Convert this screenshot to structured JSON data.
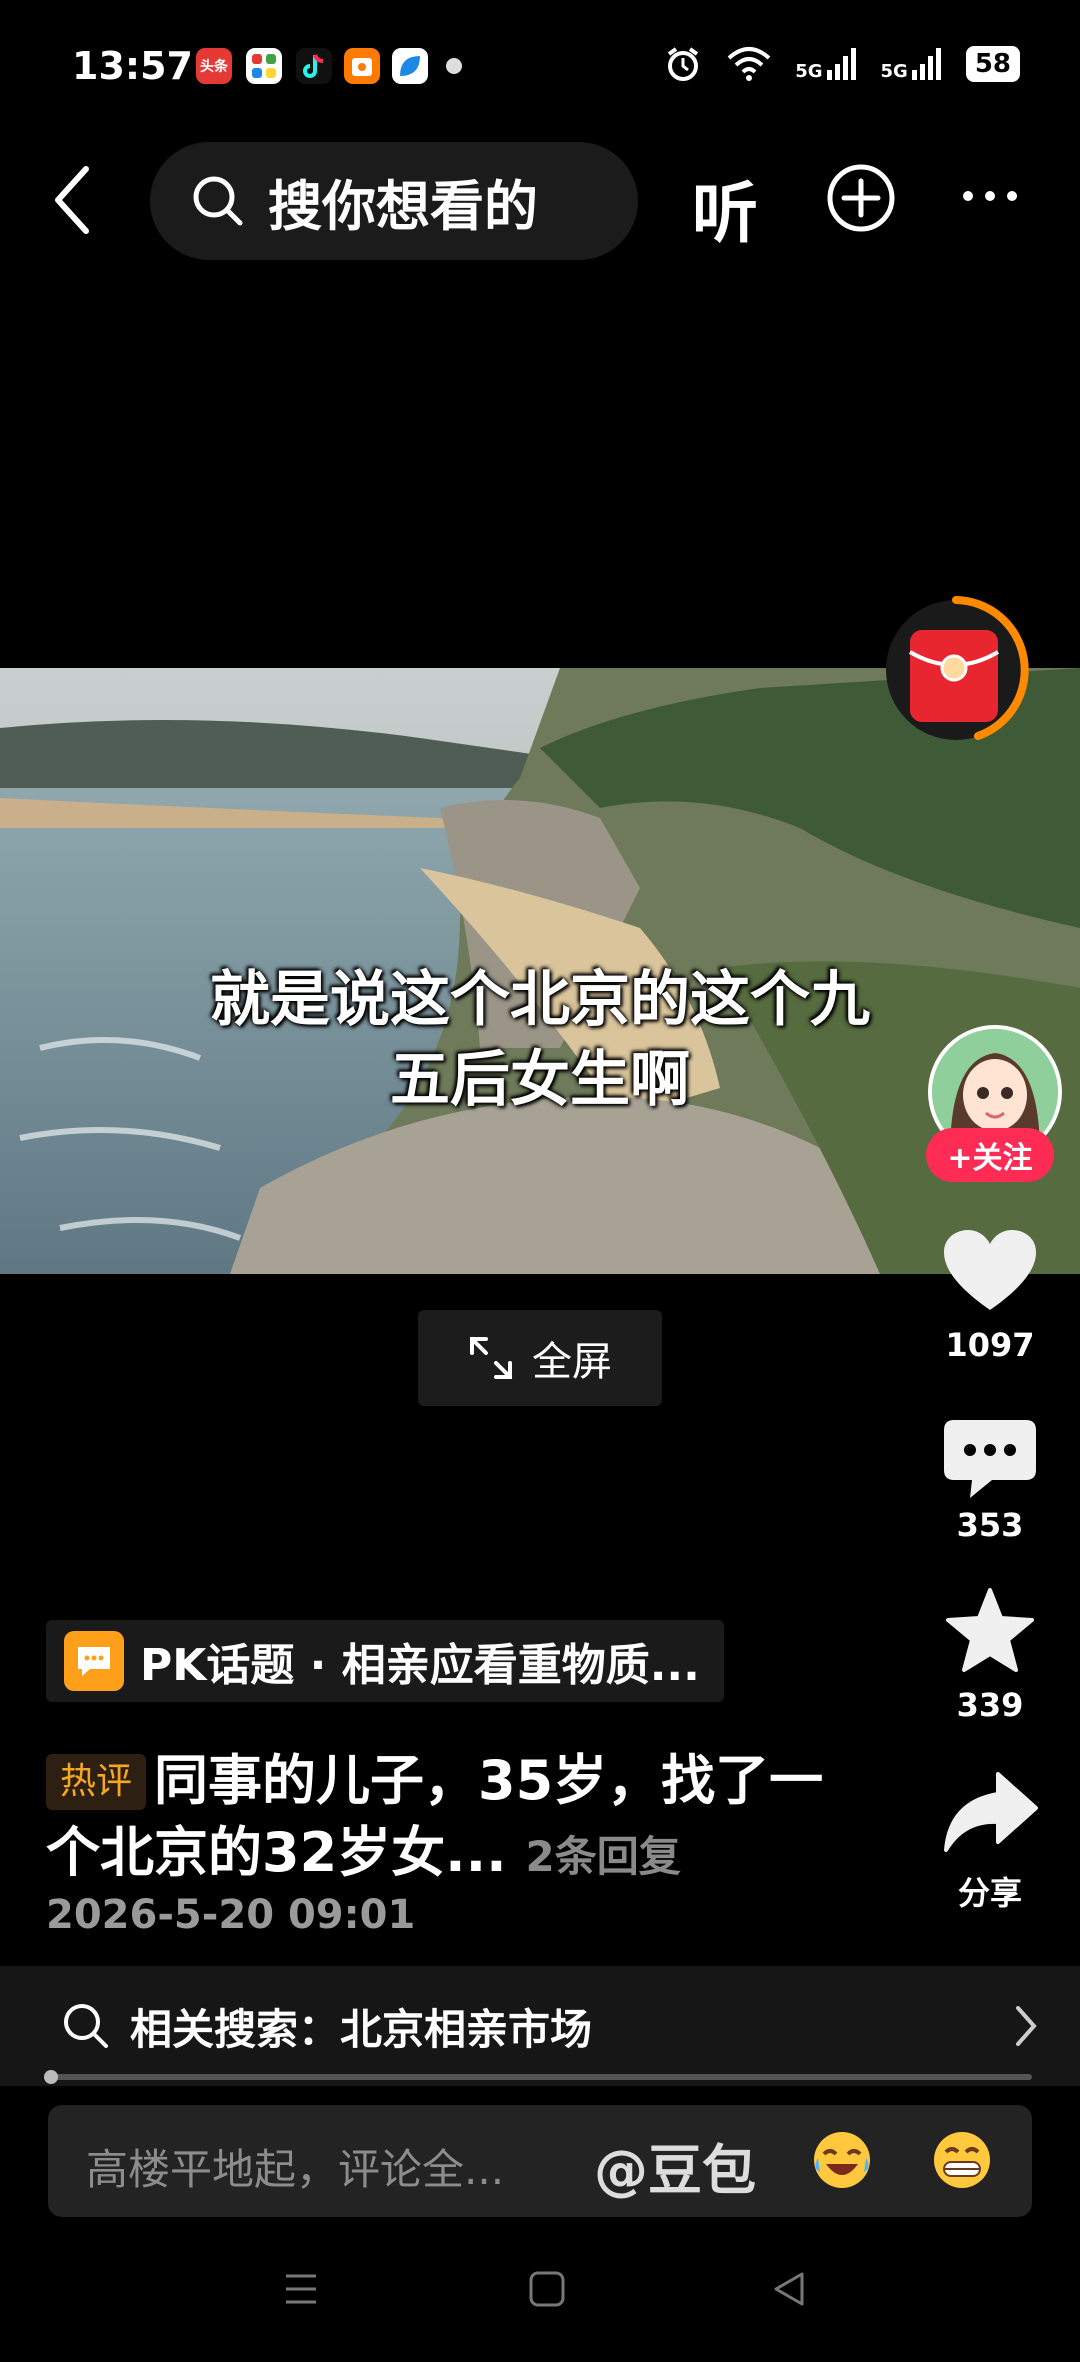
{
  "status_bar": {
    "time": "13:57",
    "battery": "58",
    "network_1": "5G",
    "network_2": "5G",
    "app_icon_1": "头条"
  },
  "top_bar": {
    "search_placeholder": "搜你想看的",
    "listen_label": "听"
  },
  "video": {
    "subtitle_line1": "就是说这个北京的这个九",
    "subtitle_line2": "五后女生啊",
    "fullscreen_label": "全屏"
  },
  "right_rail": {
    "follow_label": "+关注",
    "likes": "1097",
    "comments": "353",
    "favorites": "339",
    "share_label": "分享"
  },
  "pk_topic": {
    "label": "PK话题 · 相亲应看重物质..."
  },
  "hot_comment": {
    "badge": "热评",
    "text": "同事的儿子，35岁，找了一个北京的32岁女...",
    "replies": "2条回复",
    "date": "2026-5-20 09:01"
  },
  "related_search": {
    "label": "相关搜索：",
    "query": "北京相亲市场"
  },
  "comment_input": {
    "placeholder": "高楼平地起，评论全...",
    "mention": "@豆包"
  },
  "icons": [
    "back-icon",
    "search-icon",
    "add-circle-icon",
    "more-icon",
    "red-packet-icon",
    "heart-icon",
    "comment-icon",
    "star-icon",
    "share-icon",
    "expand-icon",
    "chevron-right-icon",
    "menu-nav-icon",
    "home-nav-icon",
    "back-nav-icon"
  ],
  "colors": {
    "accent": "#fe2c55",
    "badge": "#f5a623",
    "pk": "#ff9f1a",
    "packet": "#e8262f",
    "ring": "#ff8a00"
  }
}
